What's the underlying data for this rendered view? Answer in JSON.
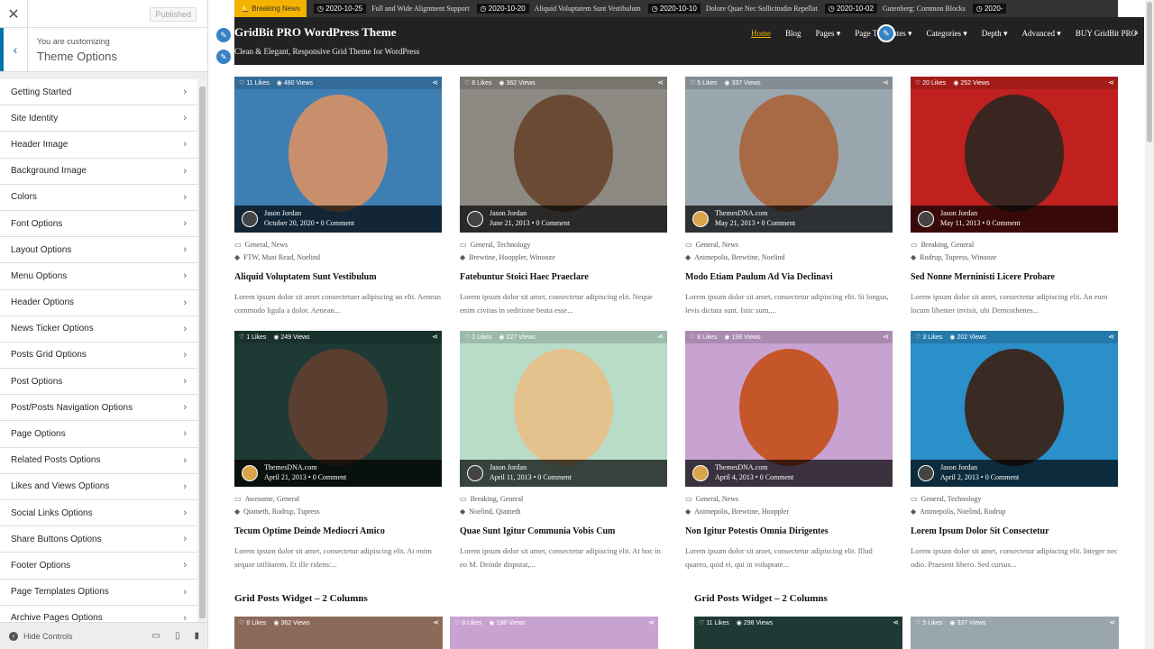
{
  "customizer": {
    "published_label": "Published",
    "subtitle": "You are customizing",
    "title": "Theme Options",
    "items": [
      "Getting Started",
      "Site Identity",
      "Header Image",
      "Background Image",
      "Colors",
      "Font Options",
      "Layout Options",
      "Menu Options",
      "Header Options",
      "News Ticker Options",
      "Posts Grid Options",
      "Post Options",
      "Post/Posts Navigation Options",
      "Page Options",
      "Related Posts Options",
      "Likes and Views Options",
      "Social Links Options",
      "Share Buttons Options",
      "Footer Options",
      "Page Templates Options",
      "Archive Pages Options"
    ],
    "hide_controls": "Hide Controls",
    "icons": {
      "close": "close-icon",
      "back": "chevron-left-icon",
      "chevron": "chevron-right-icon",
      "hide": "arrow-left-circle-icon",
      "desktop": "desktop-icon",
      "tablet": "tablet-icon",
      "mobile": "mobile-icon"
    }
  },
  "ticker": {
    "label": "Breaking News",
    "items": [
      {
        "date": "2020-10-25",
        "title": "Full and Wide Alignment Support"
      },
      {
        "date": "2020-10-20",
        "title": "Aliquid Voluptatem Sunt Vestibulum"
      },
      {
        "date": "2020-10-10",
        "title": "Dolore Quae Nec Sollicitudin Repellat"
      },
      {
        "date": "2020-10-02",
        "title": "Gutenberg: Common Blocks"
      },
      {
        "date": "2020-",
        "title": ""
      }
    ]
  },
  "header": {
    "site_title": "GridBit PRO WordPress Theme",
    "tagline": "Clean & Elegant, Responsive Grid Theme for WordPress",
    "nav": [
      "Home",
      "Blog",
      "Pages ▾",
      "Page Templates ▾",
      "Categories ▾",
      "Depth ▾",
      "Advanced ▾",
      "BUY GridBit PRO"
    ]
  },
  "posts": [
    {
      "likes": "11 Likes",
      "views": "480 Views",
      "author": "Jason Jordan",
      "date": "October 20, 2020",
      "comments": "0 Comment",
      "cats": "General, News",
      "tags": "FTW, Must Read, Noelind",
      "title": "Aliquid Voluptatem Sunt Vestibulum",
      "excerpt": "Lorem ipsum dolor sit amet consectetuer adipiscing an elit. Aenean commodo ligula a dolor. Aenean...",
      "bg": "#3e7fb3",
      "face": "#c98f6c",
      "av": "#444"
    },
    {
      "likes": "8 Likes",
      "views": "362 Views",
      "author": "Jason Jordan",
      "date": "June 21, 2013",
      "comments": "0 Comment",
      "cats": "General, Technology",
      "tags": "Brewtine, Hooppler, Winooze",
      "title": "Fatebuntur Stoici Haec Praeclare",
      "excerpt": "Lorem ipsum dolor sit amet, consectetur adipiscing elit. Neque enim civitas in seditione beata esse...",
      "bg": "#8c8a82",
      "face": "#6b4a35",
      "av": "#444"
    },
    {
      "likes": "5 Likes",
      "views": "337 Views",
      "author": "ThemesDNA.com",
      "date": "May 21, 2013",
      "comments": "0 Comment",
      "cats": "General, News",
      "tags": "Animepolis, Brewtine, Noelind",
      "title": "Modo Etiam Paulum Ad Via Declinavi",
      "excerpt": "Lorem ipsum dolor sit amet, consectetur adipiscing elit. Si longus, levis dictata sunt. Istic sum,...",
      "bg": "#9aa6ad",
      "face": "#a86a44",
      "av": "#d9a44a"
    },
    {
      "likes": "20 Likes",
      "views": "252 Views",
      "author": "Jason Jordan",
      "date": "May 11, 2013",
      "comments": "0 Comment",
      "cats": "Breaking, General",
      "tags": "Rodrup, Tupress, Winooze",
      "title": "Sed Nonne Merninisti Licere Probare",
      "excerpt": "Lorem ipsum dolor sit amet, consectetur adipiscing elit. An eum locum libenter invisit, ubi Demosthenes...",
      "bg": "#c0211e",
      "face": "#3a2520",
      "av": "#444"
    },
    {
      "likes": "1 Likes",
      "views": "249 Views",
      "author": "ThemesDNA.com",
      "date": "April 21, 2013",
      "comments": "0 Comment",
      "cats": "Awesome, General",
      "tags": "Qiameth, Rodrup, Tupress",
      "title": "Tecum Optime Deinde Mediocri Amico",
      "excerpt": "Lorem ipsum dolor sit amet, consectetur adipiscing elit. At enim sequor utilitatem. Et ille ridens:...",
      "bg": "#1e3a34",
      "face": "#5a3e30",
      "av": "#d9a44a"
    },
    {
      "likes": "1 Likes",
      "views": "227 Views",
      "author": "Jason Jordan",
      "date": "April 11, 2013",
      "comments": "0 Comment",
      "cats": "Breaking, General",
      "tags": "Noelind, Qiameth",
      "title": "Quae Sunt Igitur Communia Vobis Cum",
      "excerpt": "Lorem ipsum dolor sit amet, consectetur adipiscing elit. At hoc in eo M. Deinde disputat,...",
      "bg": "#b9dcc9",
      "face": "#e4c28e",
      "av": "#444"
    },
    {
      "likes": "8 Likes",
      "views": "198 Views",
      "author": "ThemesDNA.com",
      "date": "April 4, 2013",
      "comments": "0 Comment",
      "cats": "General, News",
      "tags": "Animepolis, Brewtine, Hooppler",
      "title": "Non Igitur Potestis Omnia Dirigentes",
      "excerpt": "Lorem ipsum dolor sit amet, consectetur adipiscing elit. Illud quaero, quid ei, qui in voluptate...",
      "bg": "#c8a3d1",
      "face": "#c5562a",
      "av": "#d9a44a"
    },
    {
      "likes": "3 Likes",
      "views": "202 Views",
      "author": "Jason Jordan",
      "date": "April 2, 2013",
      "comments": "0 Comment",
      "cats": "General, Technology",
      "tags": "Animepolis, Noelind, Rodrup",
      "title": "Lorem Ipsum Dolor Sit Consectetur",
      "excerpt": "Lorem ipsum dolor sit amet, consectetur adipiscing elit. Integer nec odio. Praesent libero. Sed cursus...",
      "bg": "#2b8fc9",
      "face": "#3a2a24",
      "av": "#444"
    }
  ],
  "widgets": [
    {
      "title": "Grid Posts Widget – 2 Columns",
      "minis": [
        {
          "likes": "8 Likes",
          "views": "362 Views",
          "bg": "#8c6a5a"
        },
        {
          "likes": "8 Likes",
          "views": "198 Views",
          "bg": "#c8a3d1"
        }
      ]
    },
    {
      "title": "Grid Posts Widget – 2 Columns",
      "minis": [
        {
          "likes": "11 Likes",
          "views": "298 Views",
          "bg": "#1e3a34"
        },
        {
          "likes": "5 Likes",
          "views": "337 Views",
          "bg": "#9aa6ad"
        }
      ]
    }
  ],
  "colors": {
    "accent": "#f3b300",
    "header_bg": "#222222",
    "customizer_accent": "#0073aa",
    "edit_shortcut": "#3582c4"
  }
}
